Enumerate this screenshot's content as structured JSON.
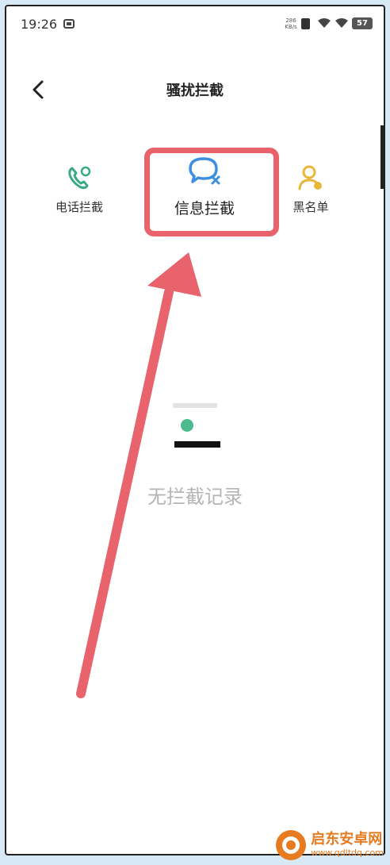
{
  "status_bar": {
    "time": "19:26",
    "net_speed_value": "286",
    "net_speed_unit": "KB/s",
    "battery": "57"
  },
  "header": {
    "title": "骚扰拦截"
  },
  "tabs": [
    {
      "label": "电话拦截",
      "icon": "phone-block-icon"
    },
    {
      "label": "信息拦截",
      "icon": "message-block-icon"
    },
    {
      "label": "黑名单",
      "icon": "blacklist-person-icon"
    }
  ],
  "empty_state": {
    "text": "无拦截记录"
  },
  "watermark": {
    "title": "启东安卓网",
    "url": "www.qdltdq.com"
  },
  "colors": {
    "highlight": "#e8636b",
    "phone_icon": "#3aaa85",
    "message_icon": "#3d8fe0",
    "blacklist_icon": "#e8b73a",
    "empty_dot": "#4dba8e",
    "watermark": "#e67b22",
    "background": "#d6e9f4"
  }
}
